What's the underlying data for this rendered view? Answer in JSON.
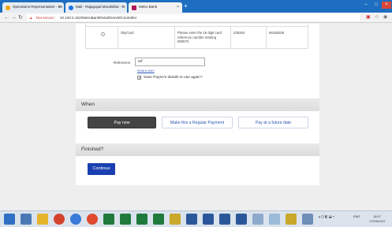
{
  "browser": {
    "tabs": [
      {
        "title": "Operations Representative - Se",
        "color": "#f0a400"
      },
      {
        "title": "Mail - Rajagopal Muralidhar - O",
        "color": "#1a73e8"
      },
      {
        "title": "Metro Bank",
        "color": "#b0145a"
      }
    ],
    "close_glyph": "×",
    "new_tab_glyph": "+",
    "not_secure": "Not secure",
    "url": "10.240.5.152/MetroBankRetail/ServletController",
    "window_controls": [
      "–",
      "□",
      "×"
    ]
  },
  "payee_row": {
    "name": "SkyCard",
    "description": "Please enter the 16 digit card reference number starting 650670",
    "sort_code": "235253",
    "account": "66158255"
  },
  "reference": {
    "label": "Reference",
    "value": "ref",
    "help_link": "What is this?"
  },
  "save_payee": {
    "checked_glyph": "✓",
    "label": "Save Payee's details to use again?"
  },
  "when": {
    "title": "When",
    "options": [
      "Pay now",
      "Make this a Regular Payment",
      "Pay at a future date"
    ],
    "selected": "Pay now"
  },
  "finished": {
    "title": "Finished?",
    "continue_label": "Continue"
  },
  "taskbar": {
    "time": "16:07",
    "date": "17/03/2019",
    "lang": "ENG"
  }
}
